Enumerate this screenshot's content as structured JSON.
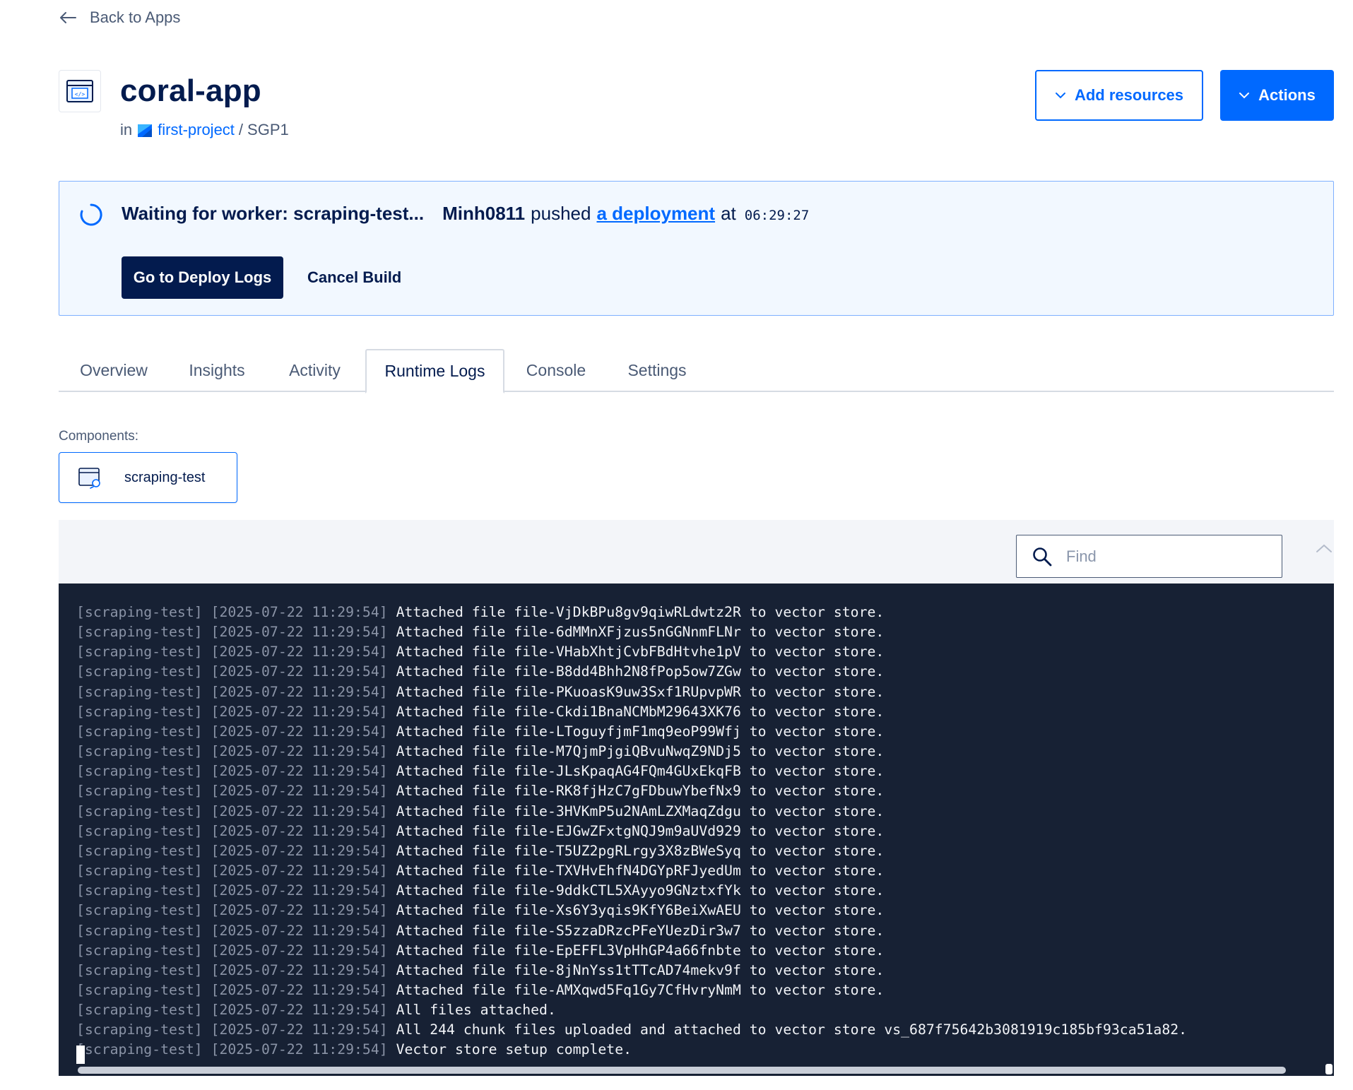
{
  "nav": {
    "back_label": "Back to Apps"
  },
  "app": {
    "name": "coral-app",
    "in_label": "in",
    "project": "first-project",
    "separator": "/",
    "region": "SGP1"
  },
  "header_actions": {
    "add_resources": "Add resources",
    "actions": "Actions"
  },
  "banner": {
    "waiting": "Waiting for worker: scraping-test...",
    "user": "Minh0811",
    "pushed": "pushed",
    "link": "a deployment",
    "at": "at",
    "time": "06:29:27",
    "deploy_logs_button": "Go to Deploy Logs",
    "cancel_button": "Cancel Build"
  },
  "tabs": [
    {
      "label": "Overview",
      "active": false
    },
    {
      "label": "Insights",
      "active": false
    },
    {
      "label": "Activity",
      "active": false
    },
    {
      "label": "Runtime Logs",
      "active": true
    },
    {
      "label": "Console",
      "active": false
    },
    {
      "label": "Settings",
      "active": false
    }
  ],
  "components": {
    "label": "Components:",
    "items": [
      {
        "name": "scraping-test"
      }
    ]
  },
  "search": {
    "placeholder": "Find",
    "value": ""
  },
  "logs": {
    "lines": [
      {
        "prefix": "[scraping-test] [2025-07-22 11:29:54]",
        "msg": "Attached file file-VjDkBPu8gv9qiwRLdwtz2R to vector store."
      },
      {
        "prefix": "[scraping-test] [2025-07-22 11:29:54]",
        "msg": "Attached file file-6dMMnXFjzus5nGGNnmFLNr to vector store."
      },
      {
        "prefix": "[scraping-test] [2025-07-22 11:29:54]",
        "msg": "Attached file file-VHabXhtjCvbFBdHtvhe1pV to vector store."
      },
      {
        "prefix": "[scraping-test] [2025-07-22 11:29:54]",
        "msg": "Attached file file-B8dd4Bhh2N8fPop5ow7ZGw to vector store."
      },
      {
        "prefix": "[scraping-test] [2025-07-22 11:29:54]",
        "msg": "Attached file file-PKuoasK9uw3Sxf1RUpvpWR to vector store."
      },
      {
        "prefix": "[scraping-test] [2025-07-22 11:29:54]",
        "msg": "Attached file file-Ckdi1BnaNCMbM29643XK76 to vector store."
      },
      {
        "prefix": "[scraping-test] [2025-07-22 11:29:54]",
        "msg": "Attached file file-LToguyfjmF1mq9eoP99Wfj to vector store."
      },
      {
        "prefix": "[scraping-test] [2025-07-22 11:29:54]",
        "msg": "Attached file file-M7QjmPjgiQBvuNwqZ9NDj5 to vector store."
      },
      {
        "prefix": "[scraping-test] [2025-07-22 11:29:54]",
        "msg": "Attached file file-JLsKpaqAG4FQm4GUxEkqFB to vector store."
      },
      {
        "prefix": "[scraping-test] [2025-07-22 11:29:54]",
        "msg": "Attached file file-RK8fjHzC7gFDbuwYbefNx9 to vector store."
      },
      {
        "prefix": "[scraping-test] [2025-07-22 11:29:54]",
        "msg": "Attached file file-3HVKmP5u2NAmLZXMaqZdgu to vector store."
      },
      {
        "prefix": "[scraping-test] [2025-07-22 11:29:54]",
        "msg": "Attached file file-EJGwZFxtgNQJ9m9aUVd929 to vector store."
      },
      {
        "prefix": "[scraping-test] [2025-07-22 11:29:54]",
        "msg": "Attached file file-T5UZ2pgRLrgy3X8zBWeSyq to vector store."
      },
      {
        "prefix": "[scraping-test] [2025-07-22 11:29:54]",
        "msg": "Attached file file-TXVHvEhfN4DGYpRFJyedUm to vector store."
      },
      {
        "prefix": "[scraping-test] [2025-07-22 11:29:54]",
        "msg": "Attached file file-9ddkCTL5XAyyo9GNztxfYk to vector store."
      },
      {
        "prefix": "[scraping-test] [2025-07-22 11:29:54]",
        "msg": "Attached file file-Xs6Y3yqis9KfY6BeiXwAEU to vector store."
      },
      {
        "prefix": "[scraping-test] [2025-07-22 11:29:54]",
        "msg": "Attached file file-S5zzaDRzcPFeYUezDir3w7 to vector store."
      },
      {
        "prefix": "[scraping-test] [2025-07-22 11:29:54]",
        "msg": "Attached file file-EpEFFL3VpHhGP4a66fnbte to vector store."
      },
      {
        "prefix": "[scraping-test] [2025-07-22 11:29:54]",
        "msg": "Attached file file-8jNnYss1tTTcAD74mekv9f to vector store."
      },
      {
        "prefix": "[scraping-test] [2025-07-22 11:29:54]",
        "msg": "Attached file file-AMXqwd5Fq1Gy7CfHvryNmM to vector store."
      },
      {
        "prefix": "[scraping-test] [2025-07-22 11:29:54]",
        "msg": "All files attached."
      },
      {
        "prefix": "[scraping-test] [2025-07-22 11:29:54]",
        "msg": "All 244 chunk files uploaded and attached to vector store vs_687f75642b3081919c185bf93ca51a82."
      },
      {
        "prefix": "[scraping-test] [2025-07-22 11:29:54]",
        "msg": "Vector store setup complete."
      }
    ]
  },
  "colors": {
    "brand_blue": "#0069ff",
    "navy": "#031b4e",
    "banner_bg": "#f2f8ff",
    "log_bg": "#172134"
  },
  "icons": {
    "back": "arrow-left-icon",
    "app": "code-window-icon",
    "project": "project-icon",
    "chevron": "chevron-down-icon",
    "spinner": "spinner-icon",
    "component": "component-icon",
    "search": "search-icon",
    "prev": "chevron-up-icon",
    "next": "chevron-down-icon"
  }
}
